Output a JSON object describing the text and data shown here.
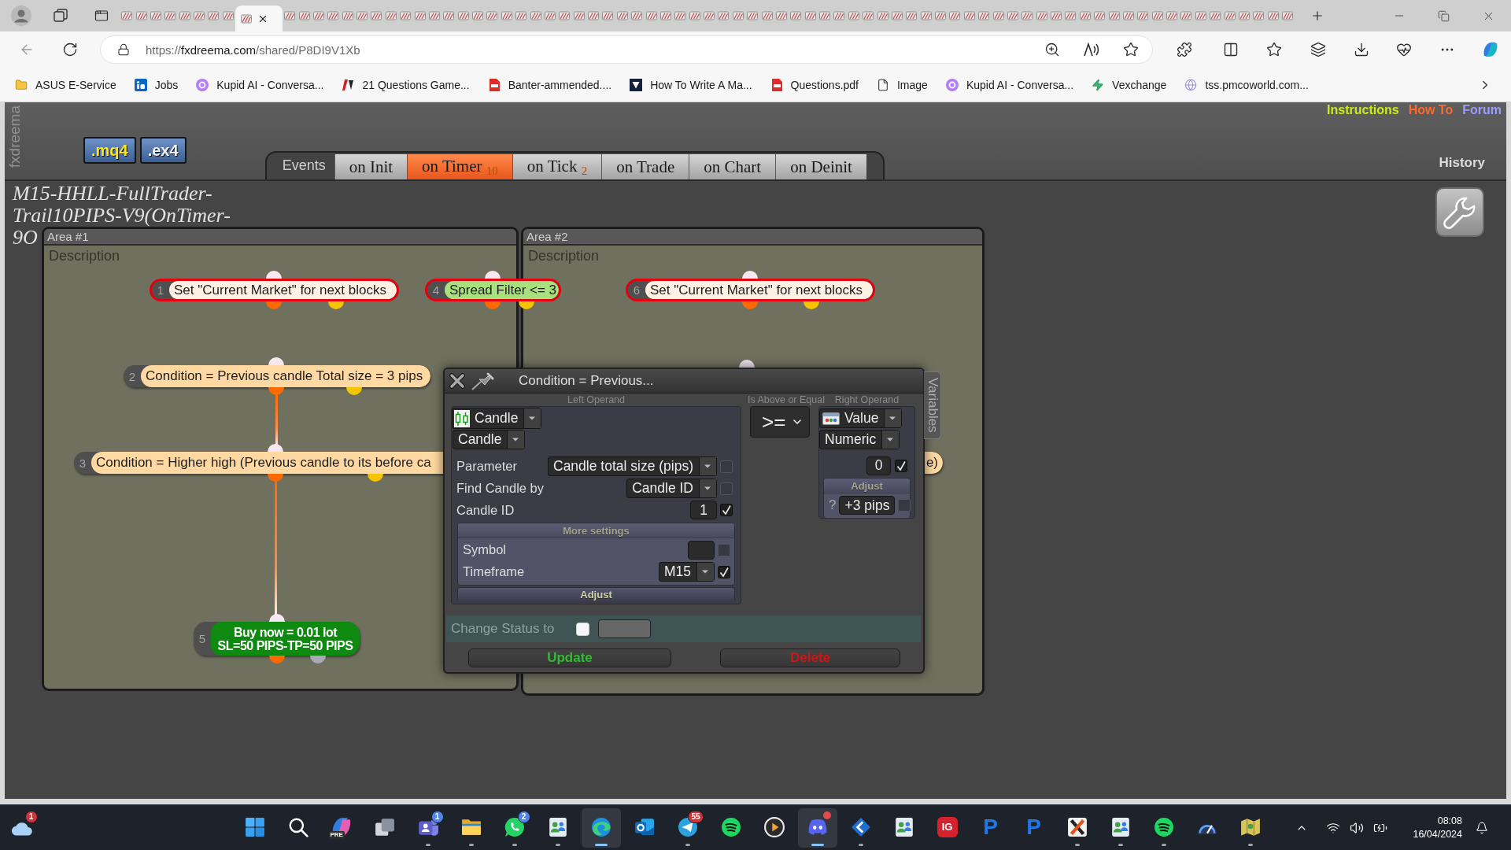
{
  "browser": {
    "tabs": [
      {
        "selected": false
      },
      {
        "selected": false
      },
      {
        "selected": false
      },
      {
        "selected": false
      },
      {
        "selected": false
      },
      {
        "selected": false
      },
      {
        "selected": false
      },
      {
        "selected": false
      },
      {
        "selected": true
      },
      {
        "selected": false
      },
      {
        "selected": false
      },
      {
        "selected": false
      },
      {
        "selected": false
      },
      {
        "selected": false
      },
      {
        "selected": false
      },
      {
        "selected": false
      },
      {
        "selected": false
      },
      {
        "selected": false
      },
      {
        "selected": false
      },
      {
        "selected": false
      },
      {
        "selected": false
      },
      {
        "selected": false
      },
      {
        "selected": false
      },
      {
        "selected": false
      },
      {
        "selected": false
      },
      {
        "selected": false
      },
      {
        "selected": false
      },
      {
        "selected": false
      },
      {
        "selected": false
      },
      {
        "selected": false
      },
      {
        "selected": false
      },
      {
        "selected": false
      },
      {
        "selected": false
      },
      {
        "selected": false
      },
      {
        "selected": false
      },
      {
        "selected": false
      },
      {
        "selected": false
      },
      {
        "selected": false
      },
      {
        "selected": false
      },
      {
        "selected": false
      },
      {
        "selected": false
      },
      {
        "selected": false
      },
      {
        "selected": false
      },
      {
        "selected": false
      },
      {
        "selected": false
      },
      {
        "selected": false
      },
      {
        "selected": false
      },
      {
        "selected": false
      },
      {
        "selected": false
      },
      {
        "selected": false
      },
      {
        "selected": false
      },
      {
        "selected": false
      },
      {
        "selected": false
      },
      {
        "selected": false
      },
      {
        "selected": false
      },
      {
        "selected": false
      },
      {
        "selected": false
      },
      {
        "selected": false
      },
      {
        "selected": false
      },
      {
        "selected": false
      },
      {
        "selected": false
      },
      {
        "selected": false
      },
      {
        "selected": false
      },
      {
        "selected": false
      },
      {
        "selected": false
      },
      {
        "selected": false
      },
      {
        "selected": false
      },
      {
        "selected": false
      },
      {
        "selected": false
      },
      {
        "selected": false
      },
      {
        "selected": false
      },
      {
        "selected": false
      },
      {
        "selected": false
      },
      {
        "selected": false
      },
      {
        "selected": false
      },
      {
        "selected": false
      },
      {
        "selected": false
      },
      {
        "selected": false
      },
      {
        "selected": false
      }
    ],
    "address": {
      "scheme": "https://",
      "host": "fxdreema.com",
      "path": "/shared/P8DI9V1Xb"
    },
    "bookmarks": [
      {
        "label": "ASUS E-Service",
        "kind": "folder"
      },
      {
        "label": "Jobs",
        "kind": "linkedin"
      },
      {
        "label": "Kupid AI - Conversa...",
        "kind": "kupid"
      },
      {
        "label": "21 Questions Game...",
        "kind": "tv"
      },
      {
        "label": "Banter-ammended....",
        "kind": "pdf"
      },
      {
        "label": "How To Write A Ma...",
        "kind": "vlogo"
      },
      {
        "label": "Questions.pdf",
        "kind": "pdf"
      },
      {
        "label": "Image",
        "kind": "file"
      },
      {
        "label": "Kupid AI - Conversa...",
        "kind": "kupid"
      },
      {
        "label": "Vexchange",
        "kind": "bolt"
      },
      {
        "label": "tss.pmcoworld.com...",
        "kind": "globe"
      }
    ]
  },
  "app": {
    "logo": "fxdreema",
    "export_buttons": [
      {
        "label": ".mq4",
        "selected": true
      },
      {
        "label": ".ex4",
        "selected": false
      }
    ],
    "events": {
      "label": "Events",
      "tabs": [
        {
          "label": "on Init",
          "selected": false
        },
        {
          "label": "on Timer",
          "count": "10",
          "selected": true
        },
        {
          "label": "on Tick",
          "count": "2",
          "selected": false
        },
        {
          "label": "on Trade",
          "selected": false
        },
        {
          "label": "on Chart",
          "selected": false
        },
        {
          "label": "on Deinit",
          "selected": false
        }
      ]
    },
    "links": [
      {
        "label": "Instructions",
        "color": "#c8ec1c"
      },
      {
        "label": "How To",
        "color": "#ff6a2a"
      },
      {
        "label": "Forum",
        "color": "#9a9cff"
      }
    ],
    "history": "History",
    "project_title": [
      "M15-HHLL-FullTrader-",
      "Trail10PIPS-V9(OnTimer-",
      "9O"
    ],
    "areas": [
      {
        "title": "Area #1",
        "description": "Description"
      },
      {
        "title": "Area #2",
        "description": "Description"
      }
    ],
    "blocks": [
      {
        "number": "1",
        "text": "Set \"Current Market\" for next blocks",
        "kind": "market",
        "highlighted": true,
        "linked_to_next": false
      },
      {
        "number": "4",
        "text": "Spread Filter <= 3",
        "kind": "filter",
        "highlighted": true,
        "linked_to_next": false
      },
      {
        "number": "6",
        "text": "Set \"Current Market\" for next blocks",
        "kind": "market",
        "highlighted": true,
        "linked_to_next": false
      },
      {
        "number": "2",
        "text": "Condition = Previous candle Total size = 3 pips",
        "kind": "condition",
        "highlighted": false,
        "linked_to_next": true
      },
      {
        "number": "3",
        "text": "Condition = Higher high (Previous candle to its before ca",
        "text_end": "e)",
        "kind": "condition",
        "highlighted": false,
        "linked_to_next": true
      },
      {
        "number": "5",
        "text": "Buy now = 0.01 lot\nSL=50 PIPS-TP=50 PIPS",
        "kind": "buy",
        "highlighted": false,
        "linked_to_next": false
      }
    ]
  },
  "dialog": {
    "title": "Condition = Previous...",
    "left_operand": {
      "heading": "Left Operand",
      "source": "Candle",
      "type": "Candle",
      "fields": [
        {
          "label": "Parameter",
          "kind": "select",
          "value": "Candle total size (pips)",
          "checked": false
        },
        {
          "label": "Find Candle by",
          "kind": "select",
          "value": "Candle ID",
          "checked": false
        },
        {
          "label": "Candle ID",
          "kind": "input",
          "value": "1",
          "checked": true
        }
      ],
      "more_settings": {
        "heading": "More settings",
        "fields": [
          {
            "label": "Symbol",
            "kind": "input",
            "checked": false
          },
          {
            "label": "Timeframe",
            "kind": "select",
            "value": "M15",
            "checked": true
          }
        ]
      },
      "adjust": "Adjust"
    },
    "operator": {
      "heading": "Is Above or Equal",
      "value": ">="
    },
    "right_operand": {
      "heading": "Right Operand",
      "source": "Value",
      "type": "Numeric",
      "value": "0",
      "checked": true,
      "adjust": {
        "heading": "Adjust",
        "help": "?",
        "value": "+3 pips",
        "checked": false
      }
    },
    "variables_tab": "Variables",
    "change_status": {
      "label": "Change Status to",
      "checked": false
    },
    "buttons": [
      {
        "label": "Update",
        "kind": "update"
      },
      {
        "label": "Delete",
        "kind": "delete"
      }
    ]
  },
  "taskbar": {
    "weather": {
      "badge": {
        "text": "1",
        "color": "#d13438"
      }
    },
    "apps": [
      {
        "kind": "start",
        "selected": false,
        "running": false
      },
      {
        "kind": "search",
        "selected": false,
        "running": false
      },
      {
        "kind": "copilot",
        "label": "PRE",
        "selected": false,
        "running": false
      },
      {
        "kind": "task-view",
        "selected": false,
        "running": false
      },
      {
        "kind": "teams",
        "badge": {
          "text": "1",
          "color": "#4f86e8"
        },
        "selected": false,
        "running": true
      },
      {
        "kind": "explorer",
        "selected": false,
        "running": true
      },
      {
        "kind": "whatsapp",
        "badge": {
          "text": "2",
          "color": "#4f86e8"
        },
        "selected": false,
        "running": true
      },
      {
        "kind": "contacts",
        "selected": false,
        "running": true
      },
      {
        "kind": "edge",
        "selected": true,
        "running": true
      },
      {
        "kind": "outlook",
        "selected": false,
        "running": false
      },
      {
        "kind": "telegram",
        "badge": {
          "text": "55",
          "color": "#d13438"
        },
        "selected": false,
        "running": true
      },
      {
        "kind": "spotify",
        "selected": false,
        "running": false
      },
      {
        "kind": "player",
        "selected": false,
        "running": false
      },
      {
        "kind": "discord",
        "badge": {
          "color": "#e5484d"
        },
        "selected": true,
        "running": true
      },
      {
        "kind": "arrow",
        "selected": false,
        "running": true
      },
      {
        "kind": "contacts",
        "selected": false,
        "running": false
      },
      {
        "kind": "tile-logo",
        "glyph": "IG",
        "selected": false,
        "running": false
      },
      {
        "kind": "letter-logo",
        "glyph": "P",
        "selected": false,
        "running": false
      },
      {
        "kind": "letter-logo",
        "glyph": "P",
        "selected": false,
        "running": false
      },
      {
        "kind": "x-app",
        "selected": false,
        "running": true
      },
      {
        "kind": "contacts",
        "selected": false,
        "running": true
      },
      {
        "kind": "spotify",
        "selected": false,
        "running": true
      },
      {
        "kind": "gauge",
        "selected": false,
        "running": false
      },
      {
        "kind": "map-app",
        "selected": false,
        "running": true
      }
    ],
    "clock": {
      "time": "08:08",
      "date": "16/04/2024"
    }
  }
}
